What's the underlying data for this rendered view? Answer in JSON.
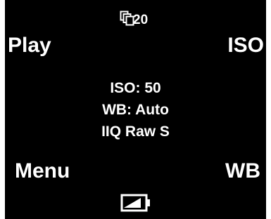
{
  "soft_keys": {
    "top_left": "Play",
    "top_right": "ISO",
    "bottom_left": "Menu",
    "bottom_right": "WB"
  },
  "counter": {
    "icon": "image-stack-icon",
    "value": "20"
  },
  "status": {
    "iso": "ISO: 50",
    "white_balance": "WB: Auto",
    "format": "IIQ Raw S"
  },
  "battery": {
    "icon": "battery-icon",
    "level": 0.8
  },
  "colors": {
    "background": "#000000",
    "foreground": "#ffffff"
  }
}
